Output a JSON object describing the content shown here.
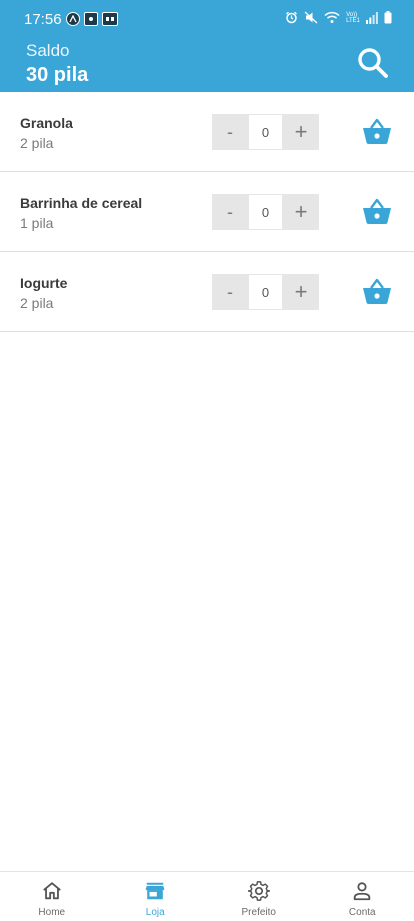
{
  "status_bar": {
    "time": "17:56",
    "left_icons": [
      "a-icon",
      "notification-icon",
      "app-icon"
    ],
    "right_icons": [
      "alarm-icon",
      "mute-icon",
      "wifi-icon",
      "signal-icon",
      "battery-icon"
    ],
    "network_label_top": "Vo))",
    "network_label_bottom": "LTE1"
  },
  "header": {
    "balance_label": "Saldo",
    "balance_value": "30 pila",
    "search_icon": "search-icon"
  },
  "products": [
    {
      "name": "Granola",
      "price": "2 pila",
      "quantity": "0",
      "minus": "-",
      "plus": "+"
    },
    {
      "name": "Barrinha de cereal",
      "price": "1 pila",
      "quantity": "0",
      "minus": "-",
      "plus": "+"
    },
    {
      "name": "Iogurte",
      "price": "2 pila",
      "quantity": "0",
      "minus": "-",
      "plus": "+"
    }
  ],
  "bottom_nav": {
    "items": [
      {
        "label": "Home",
        "icon": "home-icon"
      },
      {
        "label": "Loja",
        "icon": "store-icon"
      },
      {
        "label": "Prefeito",
        "icon": "gear-icon"
      },
      {
        "label": "Conta",
        "icon": "person-icon"
      }
    ],
    "active_index": 1
  },
  "colors": {
    "primary": "#3aa6d8",
    "stepper_bg": "#e6e6e6",
    "text_dark": "#3b3b3b",
    "text_muted": "#7a7a7a"
  }
}
